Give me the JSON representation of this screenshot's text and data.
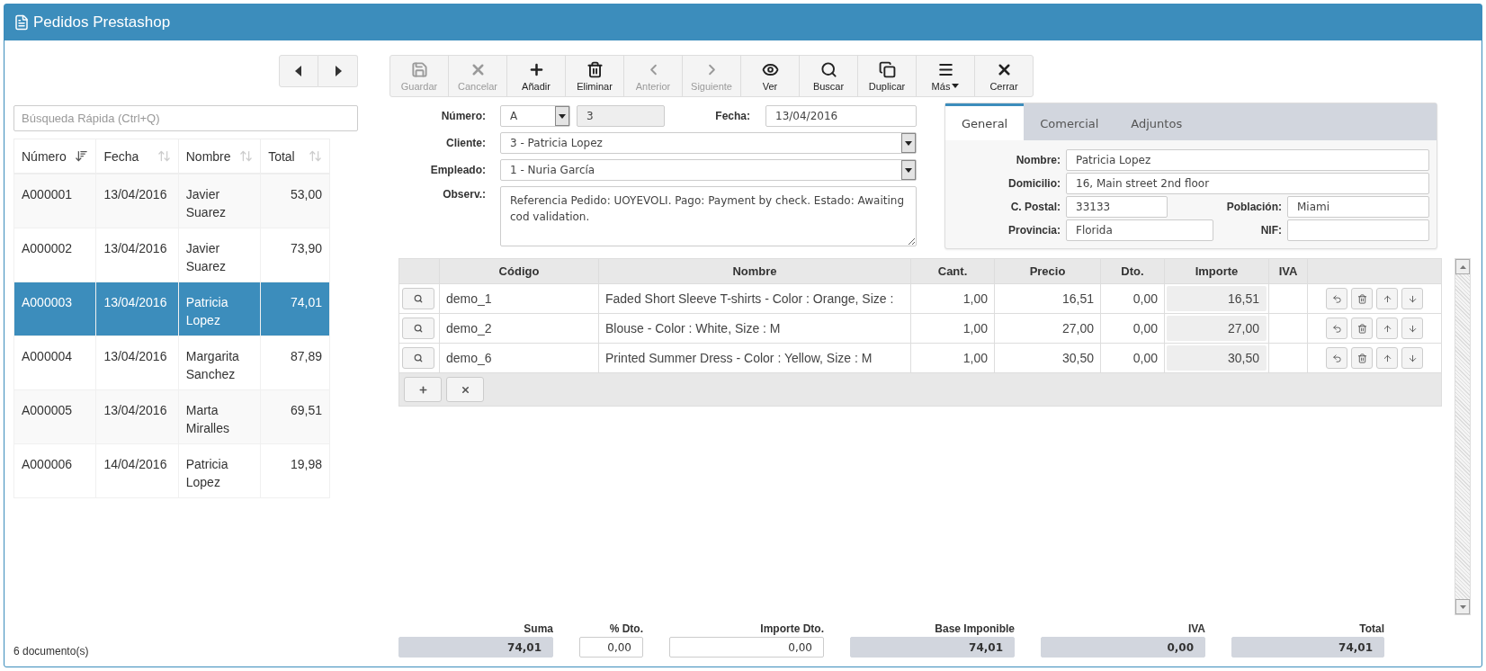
{
  "window": {
    "title": "Pedidos Prestashop"
  },
  "list": {
    "search": {
      "placeholder": "Búsqueda Rápida (Ctrl+Q)"
    },
    "columns": [
      {
        "label": "Número",
        "sorted": true
      },
      {
        "label": "Fecha",
        "sorted": false
      },
      {
        "label": "Nombre",
        "sorted": false
      },
      {
        "label": "Total",
        "sorted": false
      }
    ],
    "rows": [
      {
        "numero": "A000001",
        "fecha": "13/04/2016",
        "nombre": "Javier Suarez",
        "total": "53,00",
        "selected": false
      },
      {
        "numero": "A000002",
        "fecha": "13/04/2016",
        "nombre": "Javier Suarez",
        "total": "73,90",
        "selected": false
      },
      {
        "numero": "A000003",
        "fecha": "13/04/2016",
        "nombre": "Patricia Lopez",
        "total": "74,01",
        "selected": true
      },
      {
        "numero": "A000004",
        "fecha": "13/04/2016",
        "nombre": "Margarita Sanchez",
        "total": "87,89",
        "selected": false
      },
      {
        "numero": "A000005",
        "fecha": "13/04/2016",
        "nombre": "Marta Miralles",
        "total": "69,51",
        "selected": false
      },
      {
        "numero": "A000006",
        "fecha": "14/04/2016",
        "nombre": "Patricia Lopez",
        "total": "19,98",
        "selected": false
      }
    ],
    "count": "6 documento(s)"
  },
  "toolbar": [
    {
      "label": "Guardar",
      "kind": "save",
      "disabled": true
    },
    {
      "label": "Cancelar",
      "kind": "cancel",
      "disabled": true
    },
    {
      "label": "Añadir",
      "kind": "add",
      "disabled": false
    },
    {
      "label": "Eliminar",
      "kind": "delete",
      "disabled": false
    },
    {
      "label": "Anterior",
      "kind": "prev",
      "disabled": true
    },
    {
      "label": "Siguiente",
      "kind": "next",
      "disabled": true
    },
    {
      "label": "Ver",
      "kind": "view",
      "disabled": false
    },
    {
      "label": "Buscar",
      "kind": "search",
      "disabled": false
    },
    {
      "label": "Duplicar",
      "kind": "duplicate",
      "disabled": false
    },
    {
      "label": "Más",
      "kind": "more",
      "disabled": false
    },
    {
      "label": "Cerrar",
      "kind": "close",
      "disabled": false
    }
  ],
  "form": {
    "numero": {
      "label": "Número:",
      "serie": "A",
      "value": "3"
    },
    "fecha": {
      "label": "Fecha:",
      "value": "13/04/2016"
    },
    "cliente": {
      "label": "Cliente:",
      "value": "3 - Patricia Lopez"
    },
    "empleado": {
      "label": "Empleado:",
      "value": "1 - Nuria García"
    },
    "observaciones": {
      "label": "Observ.:",
      "value": "Referencia Pedido: UOYEVOLI. Pago: Payment by check. Estado: Awaiting cod validation."
    }
  },
  "tabs": [
    {
      "label": "General",
      "selected": true
    },
    {
      "label": "Comercial",
      "selected": false
    },
    {
      "label": "Adjuntos",
      "selected": false
    }
  ],
  "general": {
    "nombre": {
      "label": "Nombre:",
      "value": "Patricia Lopez"
    },
    "domicilio": {
      "label": "Domicilio:",
      "value": "16, Main street 2nd floor"
    },
    "codigo_postal": {
      "label": "C. Postal:",
      "value": "33133"
    },
    "poblacion": {
      "label": "Población:",
      "value": "Miami"
    },
    "provincia": {
      "label": "Provincia:",
      "value": "Florida"
    },
    "nif": {
      "label": "NIF:"
    }
  },
  "lines": {
    "columns": [
      "Código",
      "Nombre",
      "Cant.",
      "Precio",
      "Dto.",
      "Importe",
      "IVA"
    ],
    "rows": [
      {
        "codigo": "demo_1",
        "nombre": "Faded Short Sleeve T-shirts - Color : Orange, Size :",
        "cant": "1,00",
        "precio": "16,51",
        "dto": "0,00",
        "importe": "16,51"
      },
      {
        "codigo": "demo_2",
        "nombre": "Blouse - Color : White, Size : M",
        "cant": "1,00",
        "precio": "27,00",
        "dto": "0,00",
        "importe": "27,00"
      },
      {
        "codigo": "demo_6",
        "nombre": "Printed Summer Dress - Color : Yellow, Size : M",
        "cant": "1,00",
        "precio": "30,50",
        "dto": "0,00",
        "importe": "30,50"
      }
    ]
  },
  "totals": [
    {
      "label": "Suma",
      "value": "74,01",
      "kind": "readonly"
    },
    {
      "label": "% Dto.",
      "value": "0,00",
      "kind": "input"
    },
    {
      "label": "Importe Dto.",
      "value": "0,00",
      "kind": "input"
    },
    {
      "label": "Base Imponible",
      "value": "74,01",
      "kind": "readonly"
    },
    {
      "label": "IVA",
      "value": "0,00",
      "kind": "readonly"
    },
    {
      "label": "Total",
      "value": "74,01",
      "kind": "readonly"
    }
  ]
}
